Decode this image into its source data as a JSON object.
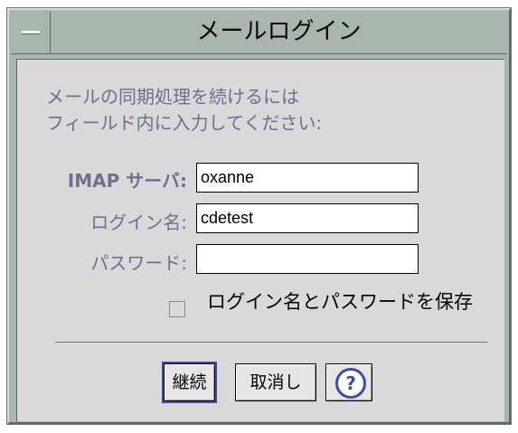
{
  "window": {
    "title": "メールログイン"
  },
  "instructions": {
    "line1": "メールの同期処理を続けるには",
    "line2": "フィールド内に入力してください:"
  },
  "form": {
    "imap_label": "IMAP サーバ:",
    "imap_value": "oxanne",
    "login_label": "ログイン名:",
    "login_value": "cdetest",
    "password_label": "パスワード:",
    "password_value": ""
  },
  "save_option": {
    "label": "ログイン名とパスワードを保存",
    "checked": false
  },
  "buttons": {
    "continue": "継続",
    "cancel": "取消し",
    "help": "?"
  },
  "icons": {
    "window_menu": "window-menu-icon",
    "help": "help-icon"
  },
  "colors": {
    "frame": "#a9b6b0",
    "label_text": "#6e7090",
    "accent": "#3b4da8"
  }
}
